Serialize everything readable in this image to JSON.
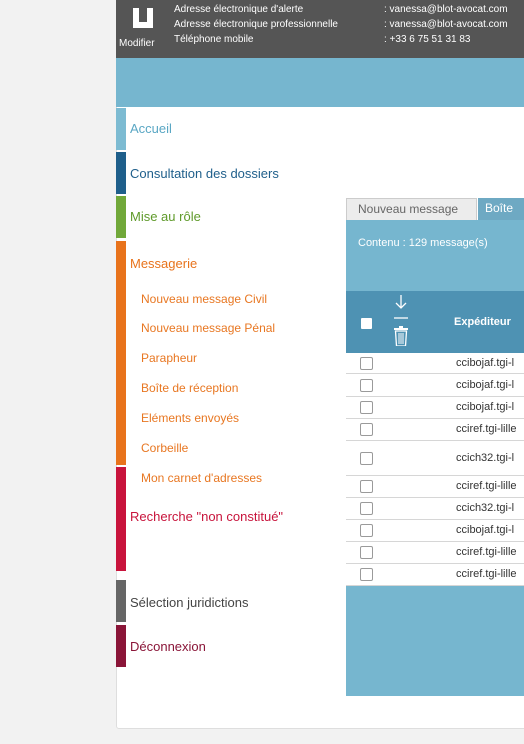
{
  "header": {
    "edit_label": "Modifier",
    "rows": [
      {
        "label": "Adresse électronique d'alerte",
        "value": ": vanessa@blot-avocat.com"
      },
      {
        "label": "Adresse électronique professionnelle",
        "value": ": vanessa@blot-avocat.com"
      },
      {
        "label": "Téléphone mobile",
        "value": ": +33 6 75 51 31 83"
      }
    ]
  },
  "nav": {
    "accueil": "Accueil",
    "consultation": "Consultation des dossiers",
    "mise_au_role": "Mise au rôle",
    "messagerie": "Messagerie",
    "messagerie_items": [
      "Nouveau message Civil",
      "Nouveau message Pénal",
      "Parapheur",
      "Boîte de réception",
      "Eléments envoyés",
      "Corbeille",
      "Mon carnet d'adresses"
    ],
    "recherche": "Recherche \"non constitué\"",
    "selection": "Sélection juridictions",
    "deconnexion": "Déconnexion"
  },
  "tabs": {
    "new_message": "Nouveau message",
    "inbox": "Boîte"
  },
  "messages": {
    "count": "Contenu : 129 message(s)",
    "col_sender": "Expéditeur",
    "rows": [
      {
        "sender": "ccibojaf.tgi-l"
      },
      {
        "sender": "ccibojaf.tgi-l"
      },
      {
        "sender": "ccibojaf.tgi-l"
      },
      {
        "sender": "cciref.tgi-lille"
      },
      {
        "sender": "ccich32.tgi-l"
      },
      {
        "sender": "cciref.tgi-lille"
      },
      {
        "sender": "ccich32.tgi-l"
      },
      {
        "sender": "ccibojaf.tgi-l"
      },
      {
        "sender": "cciref.tgi-lille"
      },
      {
        "sender": "cciref.tgi-lille"
      }
    ]
  },
  "colors": {
    "accueil": "#7dbbd2",
    "consultation": "#1f5f8b",
    "mise_au_role": "#71a83a",
    "messagerie": "#e8731c",
    "recherche": "#c8143c",
    "selection": "#666666",
    "deconnexion": "#8a1538"
  }
}
